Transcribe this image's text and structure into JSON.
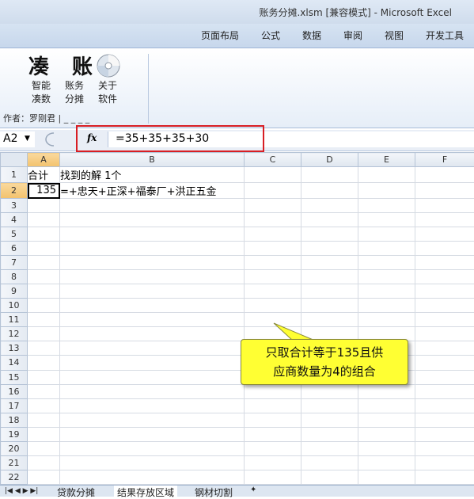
{
  "window": {
    "title": "账务分摊.xlsm  [兼容模式] - Microsoft Excel"
  },
  "ribbon": {
    "tabs": [
      "页面布局",
      "公式",
      "数据",
      "审阅",
      "视图",
      "开发工具"
    ],
    "addin_title": "凑 账",
    "buttons": [
      {
        "line1": "智能",
        "line2": "凑数"
      },
      {
        "line1": "账务",
        "line2": "分摊"
      },
      {
        "line1": "关于",
        "line2": "软件"
      }
    ],
    "author": "作者：罗刚君 | _ _ _ _"
  },
  "formula_bar": {
    "name_box": "A2",
    "fx_label": "fx",
    "formula": "=35+35+35+30"
  },
  "sheet": {
    "columns": [
      "A",
      "B",
      "C",
      "D",
      "E",
      "F"
    ],
    "rows": [
      "1",
      "2",
      "3",
      "4",
      "5",
      "6",
      "7",
      "8",
      "9",
      "10",
      "11",
      "12",
      "13",
      "14",
      "15",
      "16",
      "17",
      "18",
      "19",
      "20",
      "21",
      "22"
    ],
    "A1": "合计",
    "B1": "找到的解 1个",
    "A2": "135",
    "B2": "=+忠天+正深+福泰厂+洪正五金"
  },
  "callout": {
    "line1": "只取合计等于135且供",
    "line2": "应商数量为4的组合"
  },
  "sheet_tabs": [
    "贷款分摊",
    "结果存放区域",
    "钢材切割"
  ],
  "colors": {
    "highlight_red": "#d81e24",
    "callout_yellow": "#ffff33",
    "selected_header": "#f3c26d"
  }
}
